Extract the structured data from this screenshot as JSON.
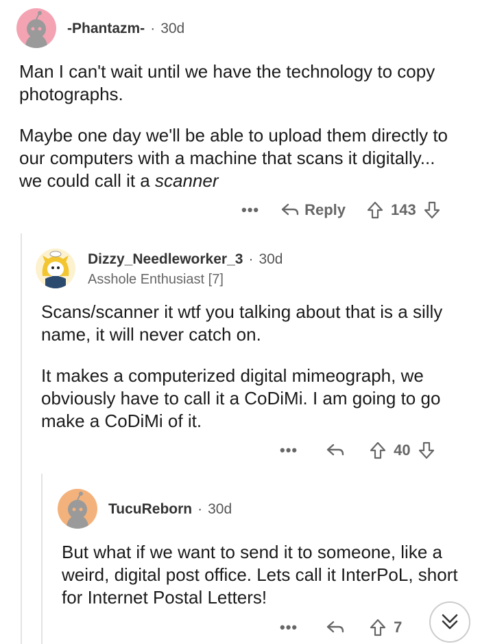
{
  "comments": [
    {
      "user": "-Phantazm-",
      "age": "30d",
      "paragraphs": [
        "Man I can't wait until we have the technology to copy photographs.",
        "Maybe one day we'll be able to upload them directly to our computers with a machine that scans it digitally... we could call it a "
      ],
      "emphasis": "scanner",
      "reply_label": "Reply",
      "votes": "143",
      "avatar_color": "#f4a3b3"
    },
    {
      "user": "Dizzy_Needleworker_3",
      "age": "30d",
      "flair": "Asshole Enthusiast [7]",
      "paragraphs": [
        "Scans/scanner it wtf you talking about that is a silly name, it will never catch on.",
        "It makes a computerized digital mimeograph, we obviously have to call it a CoDiMi. I am going to go make a CoDiMi of it."
      ],
      "votes": "40",
      "avatar_color": "#f2c531"
    },
    {
      "user": "TucuReborn",
      "age": "30d",
      "paragraphs": [
        "But what if we want to send it to someone, like a weird, digital post office. Lets call it InterPoL, short for Internet Postal Letters!"
      ],
      "votes": "7",
      "avatar_color": "#f3b27c"
    }
  ],
  "colors": {
    "text": "#1a1a1b",
    "meta": "#555555",
    "thread_line": "#e3e3e3"
  },
  "icons": {
    "more": "more-dots-icon",
    "reply": "reply-arrow-icon",
    "upvote": "upvote-arrow-icon",
    "downvote": "downvote-arrow-icon",
    "collapse": "double-chevron-down-icon"
  }
}
